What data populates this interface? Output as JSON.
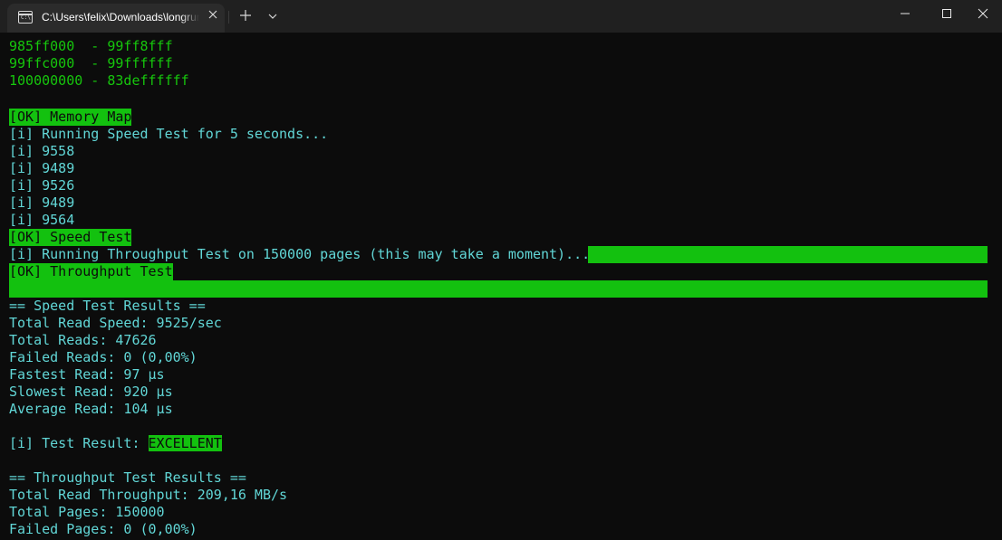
{
  "window": {
    "tab_title": "C:\\Users\\felix\\Downloads\\longrun",
    "tab_icon": "terminal-icon",
    "close_tab_icon": "close-icon",
    "new_tab_icon": "plus-icon",
    "dropdown_icon": "chevron-down-icon",
    "minimize_icon": "minimize-icon",
    "maximize_icon": "maximize-icon",
    "close_window_icon": "close-icon"
  },
  "colors": {
    "background": "#0c0c0c",
    "titlebar": "#202020",
    "text_cyan": "#61d6d6",
    "text_green": "#16c60c",
    "highlight_green": "#13c10f"
  },
  "terminal": {
    "memory_ranges": [
      "985ff000  - 99ff8fff",
      "99ffc000  - 99ffffff",
      "100000000 - 83deffffff"
    ],
    "ok_memory_map": "[OK] Memory Map",
    "speed_running": "[i] Running Speed Test for 5 seconds...",
    "speed_samples": [
      "[i] 9558",
      "[i] 9489",
      "[i] 9526",
      "[i] 9489",
      "[i] 9564"
    ],
    "ok_speed_test": "[OK] Speed Test",
    "throughput_running": "[i] Running Throughput Test on 150000 pages (this may take a moment)...",
    "ok_throughput_test": "[OK] Throughput Test",
    "speed_results": {
      "header": "== Speed Test Results ==",
      "lines": [
        "Total Read Speed: 9525/sec",
        "Total Reads: 47626",
        "Failed Reads: 0 (0,00%)",
        "Fastest Read: 97 µs",
        "Slowest Read: 920 µs",
        "Average Read: 104 µs"
      ]
    },
    "test_result_prefix": "[i] Test Result: ",
    "test_result_value": "EXCELLENT",
    "throughput_results": {
      "header": "== Throughput Test Results ==",
      "lines": [
        "Total Read Throughput: 209,16 MB/s",
        "Total Pages: 150000",
        "Failed Pages: 0 (0,00%)"
      ]
    }
  }
}
